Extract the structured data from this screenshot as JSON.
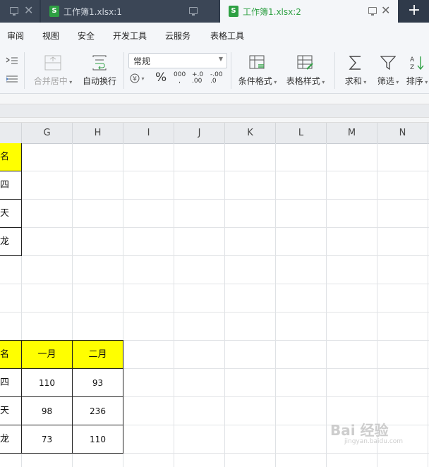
{
  "tabs": [
    {
      "label": ""
    },
    {
      "label": "工作簿1.xlsx:1"
    },
    {
      "label": "工作簿1.xlsx:2"
    }
  ],
  "tab_icon_letter": "S",
  "new_tab": "+",
  "menu": [
    "审阅",
    "视图",
    "安全",
    "开发工具",
    "云服务",
    "表格工具"
  ],
  "toolbar": {
    "merge_label": "合并居中",
    "wrap_label": "自动换行",
    "number_format_value": "常规",
    "percent": "%",
    "thousands": "000",
    "decimal_inc": "+.0",
    "decimal_dec": "-.00",
    "cond_format_label": "条件格式",
    "table_style_label": "表格样式",
    "sum_label": "求和",
    "filter_label": "筛选",
    "sort_label": "排序"
  },
  "columns": [
    "G",
    "H",
    "I",
    "J",
    "K",
    "L",
    "M",
    "N"
  ],
  "table1": {
    "header": "名",
    "rows": [
      "四",
      "天",
      "龙"
    ]
  },
  "table2": {
    "headers": [
      "名",
      "一月",
      "二月"
    ],
    "rows": [
      [
        "四",
        "110",
        "93"
      ],
      [
        "天",
        "98",
        "236"
      ],
      [
        "龙",
        "73",
        "110"
      ]
    ]
  },
  "watermark": {
    "text": "Bai 经验",
    "sub": "jingyan.baidu.com"
  },
  "colors": {
    "accent_green": "#2ea043",
    "header_yellow": "#ffff00"
  }
}
